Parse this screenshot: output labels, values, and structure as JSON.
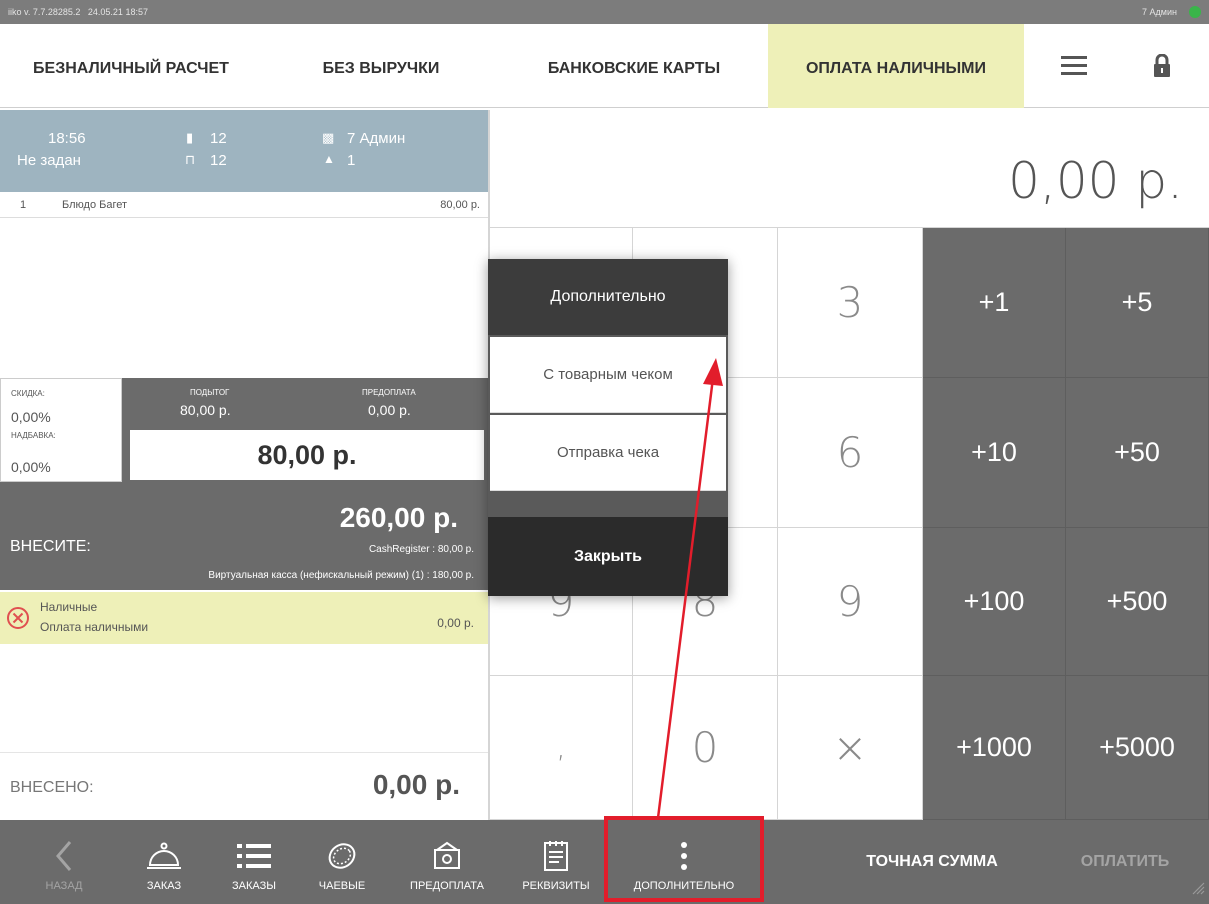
{
  "statusbar": {
    "version": "iiko v. 7.7.28285.2",
    "datetime": "24.05.21 18:57",
    "user": "7 Админ"
  },
  "tabs": [
    {
      "label": "БЕЗНАЛИЧНЫЙ РАСЧЕТ"
    },
    {
      "label": "БЕЗ ВЫРУЧКИ"
    },
    {
      "label": "БАНКОВСКИЕ КАРТЫ"
    },
    {
      "label": "ОПЛАТА НАЛИЧНЫМИ"
    }
  ],
  "order": {
    "time": "18:56",
    "customer": "Не задан",
    "table_num": "12",
    "section_num": "12",
    "waiter": "7 Админ",
    "guests": "1",
    "items": [
      {
        "num": "1",
        "name": "Блюдо Багет",
        "price": "80,00 р."
      }
    ]
  },
  "totals": {
    "discount_label": "СКИДКА:",
    "discount_value": "0,00%",
    "surcharge_label": "НАДБАВКА:",
    "surcharge_value": "0,00%",
    "subtotal_label": "ПОДЫТОГ",
    "subtotal_value": "80,00 р.",
    "prepay_label": "ПРЕДОПЛАТА",
    "prepay_value": "0,00 р.",
    "total": "80,00 р."
  },
  "due": {
    "label": "ВНЕСИТЕ:",
    "amount": "260,00 р.",
    "line1": "CashRegister : 80,00 р.",
    "line2": "Виртуальная касса (нефискальный режим) (1) : 180,00 р."
  },
  "payment": {
    "type": "Наличные",
    "subtitle": "Оплата наличными",
    "amount": "0,00 р."
  },
  "paid": {
    "label": "ВНЕСЕНО:",
    "amount": "0,00 р."
  },
  "display_amount": "0,00 р.",
  "keypad": {
    "digits": [
      "3",
      "6",
      "9",
      "7",
      "8",
      ",",
      "0",
      "×"
    ],
    "quick": [
      "+1",
      "+5",
      "+10",
      "+50",
      "+100",
      "+500",
      "+1000",
      "+5000"
    ]
  },
  "modal": {
    "title": "Дополнительно",
    "item1": "С товарным чеком",
    "item2": "Отправка чека",
    "close": "Закрыть"
  },
  "toolbar": {
    "back": "НАЗАД",
    "order": "ЗАКАЗ",
    "orders": "ЗАКАЗЫ",
    "tips": "ЧАЕВЫЕ",
    "prepay": "ПРЕДОПЛАТА",
    "details": "РЕКВИЗИТЫ",
    "more": "ДОПОЛНИТЕЛЬНО",
    "exact": "ТОЧНАЯ СУММА",
    "pay": "ОПЛАТИТЬ"
  },
  "colors": {
    "active_tab": "#eef0b8",
    "panel_dark": "#6b6b6b",
    "order_header": "#9eb4c0",
    "annotation_red": "#e21d2b"
  }
}
